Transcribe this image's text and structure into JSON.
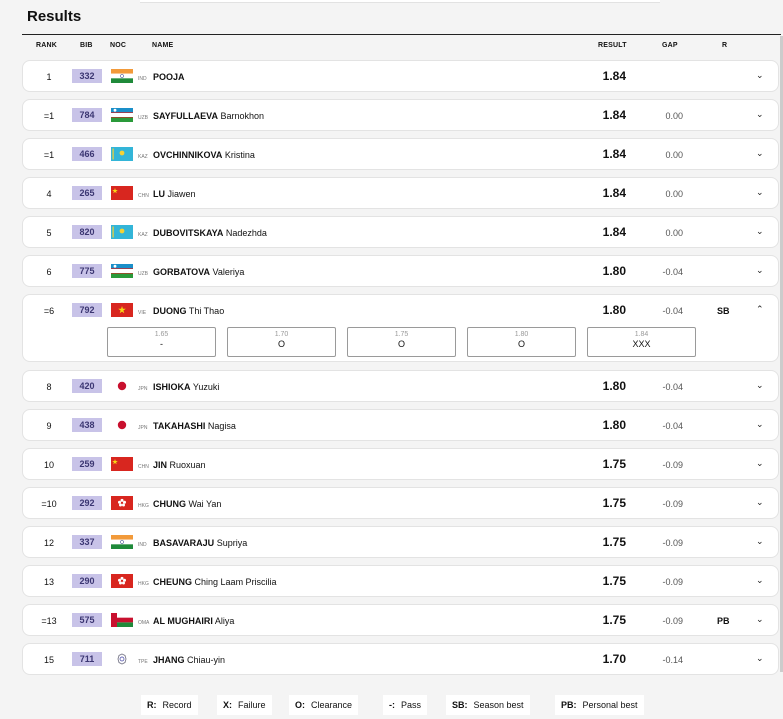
{
  "page": {
    "title": "Results"
  },
  "columns": {
    "rank": "RANK",
    "bib": "BIB",
    "noc": "NOC",
    "name": "NAME",
    "result": "RESULT",
    "gap": "GAP",
    "record": "R"
  },
  "rows": [
    {
      "rank": "1",
      "bib": "332",
      "noc": "IND",
      "flag": "india",
      "surname": "POOJA",
      "given": "",
      "result": "1.84",
      "gap": "",
      "record": ""
    },
    {
      "rank": "=1",
      "bib": "784",
      "noc": "UZB",
      "flag": "uzbekistan",
      "surname": "SAYFULLAEVA",
      "given": "Barnokhon",
      "result": "1.84",
      "gap": "0.00",
      "record": ""
    },
    {
      "rank": "=1",
      "bib": "466",
      "noc": "KAZ",
      "flag": "kazakhstan",
      "surname": "OVCHINNIKOVA",
      "given": "Kristina",
      "result": "1.84",
      "gap": "0.00",
      "record": ""
    },
    {
      "rank": "4",
      "bib": "265",
      "noc": "CHN",
      "flag": "china",
      "surname": "LU",
      "given": "Jiawen",
      "result": "1.84",
      "gap": "0.00",
      "record": ""
    },
    {
      "rank": "5",
      "bib": "820",
      "noc": "KAZ",
      "flag": "kazakhstan",
      "surname": "DUBOVITSKAYA",
      "given": "Nadezhda",
      "result": "1.84",
      "gap": "0.00",
      "record": ""
    },
    {
      "rank": "6",
      "bib": "775",
      "noc": "UZB",
      "flag": "uzbekistan",
      "surname": "GORBATOVA",
      "given": "Valeriya",
      "result": "1.80",
      "gap": "-0.04",
      "record": ""
    },
    {
      "rank": "=6",
      "bib": "792",
      "noc": "VIE",
      "flag": "vietnam",
      "surname": "DUONG",
      "given": "Thi Thao",
      "result": "1.80",
      "gap": "-0.04",
      "record": "SB",
      "attempts": [
        {
          "height": "1.65",
          "mark": "-"
        },
        {
          "height": "1.70",
          "mark": "O"
        },
        {
          "height": "1.75",
          "mark": "O"
        },
        {
          "height": "1.80",
          "mark": "O"
        },
        {
          "height": "1.84",
          "mark": "XXX"
        }
      ]
    },
    {
      "rank": "8",
      "bib": "420",
      "noc": "JPN",
      "flag": "japan",
      "surname": "ISHIOKA",
      "given": "Yuzuki",
      "result": "1.80",
      "gap": "-0.04",
      "record": ""
    },
    {
      "rank": "9",
      "bib": "438",
      "noc": "JPN",
      "flag": "japan",
      "surname": "TAKAHASHI",
      "given": "Nagisa",
      "result": "1.80",
      "gap": "-0.04",
      "record": ""
    },
    {
      "rank": "10",
      "bib": "259",
      "noc": "CHN",
      "flag": "china",
      "surname": "JIN",
      "given": "Ruoxuan",
      "result": "1.75",
      "gap": "-0.09",
      "record": ""
    },
    {
      "rank": "=10",
      "bib": "292",
      "noc": "HKG",
      "flag": "hongkong",
      "surname": "CHUNG",
      "given": "Wai Yan",
      "result": "1.75",
      "gap": "-0.09",
      "record": ""
    },
    {
      "rank": "12",
      "bib": "337",
      "noc": "IND",
      "flag": "india",
      "surname": "BASAVARAJU",
      "given": "Supriya",
      "result": "1.75",
      "gap": "-0.09",
      "record": ""
    },
    {
      "rank": "13",
      "bib": "290",
      "noc": "HKG",
      "flag": "hongkong",
      "surname": "CHEUNG",
      "given": "Ching Laam Priscilia",
      "result": "1.75",
      "gap": "-0.09",
      "record": ""
    },
    {
      "rank": "=13",
      "bib": "575",
      "noc": "OMA",
      "flag": "oman",
      "surname": "AL MUGHAIRI",
      "given": "Aliya",
      "result": "1.75",
      "gap": "-0.09",
      "record": "PB"
    },
    {
      "rank": "15",
      "bib": "711",
      "noc": "TPE",
      "flag": "tpe",
      "surname": "JHANG",
      "given": "Chiau-yin",
      "result": "1.70",
      "gap": "-0.14",
      "record": ""
    }
  ],
  "legend": [
    {
      "key": "R:",
      "label": "Record"
    },
    {
      "key": "X:",
      "label": "Failure"
    },
    {
      "key": "O:",
      "label": "Clearance"
    },
    {
      "key": "-:",
      "label": "Pass"
    },
    {
      "key": "SB:",
      "label": "Season best"
    },
    {
      "key": "PB:",
      "label": "Personal best"
    }
  ],
  "colors": {
    "bib_bg": "#c8c3e8",
    "bib_text": "#3b3672",
    "row_bg": "#ffffff",
    "page_bg": "#f4f4f4"
  }
}
